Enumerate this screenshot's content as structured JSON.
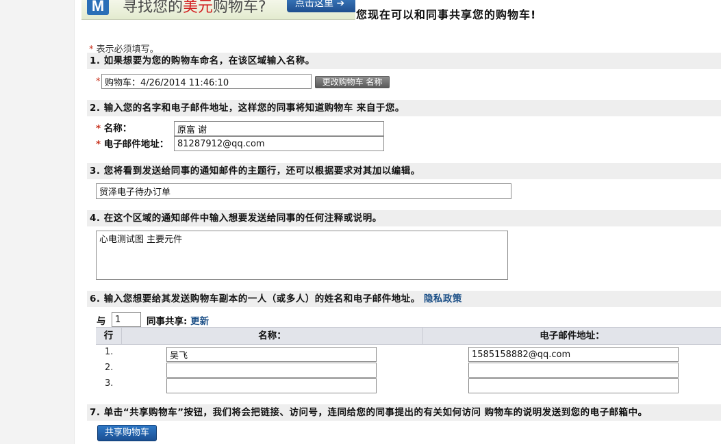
{
  "banner": {
    "logo_letter": "M",
    "text_prefix": "寻找您的",
    "text_highlight": "美元",
    "text_suffix": "购物车?",
    "button_label": "点击这里 ➔"
  },
  "headline": "您现在可以和同事共享您的购物车!",
  "required_note": "表示必须填写。",
  "required_star": "*",
  "section1": {
    "title": "1. 如果想要为您的购物车命名，在该区域输入名称。",
    "cart_name_value": "购物车：4/26/2014 11:46:10",
    "rename_button": "更改购物车 名称"
  },
  "section2": {
    "title": "2. 输入您的名字和电子邮件地址，这样您的同事将知道购物车 来自于您。",
    "name_label": "名称：",
    "name_value": "原富 谢",
    "email_label": "电子邮件地址：",
    "email_value": "81287912@qq.com"
  },
  "section3": {
    "title": "3. 您将看到发送给同事的通知邮件的主题行，还可以根据要求对其加以编辑。",
    "subject_value": "贸泽电子待办订单"
  },
  "section4": {
    "title": "4. 在这个区域的通知邮件中输入想要发送给同事的任何注释或说明。",
    "notes_value": "心电测试图 主要元件"
  },
  "section6": {
    "title": "6. 输入您想要给其发送购物车副本的一人（或多人）的姓名和电子邮件地址。",
    "privacy_link": "隐私政策",
    "with_label": "与",
    "count_value": "1",
    "colleagues_label": "同事共享:",
    "update_link": "更新",
    "headers": {
      "row": "行",
      "name": "名称：",
      "email": "电子邮件地址："
    },
    "rows": [
      {
        "num": "1.",
        "name": "吴飞",
        "email": "1585158882@qq.com"
      },
      {
        "num": "2.",
        "name": "",
        "email": ""
      },
      {
        "num": "3.",
        "name": "",
        "email": ""
      }
    ]
  },
  "section7": {
    "title": "7. 单击“共享购物车”按钮，我们将会把链接、访问号，连同给您的同事提出的有关如何访问 购物车的说明发送到您的电子邮箱中。",
    "share_button": "共享购物车"
  }
}
